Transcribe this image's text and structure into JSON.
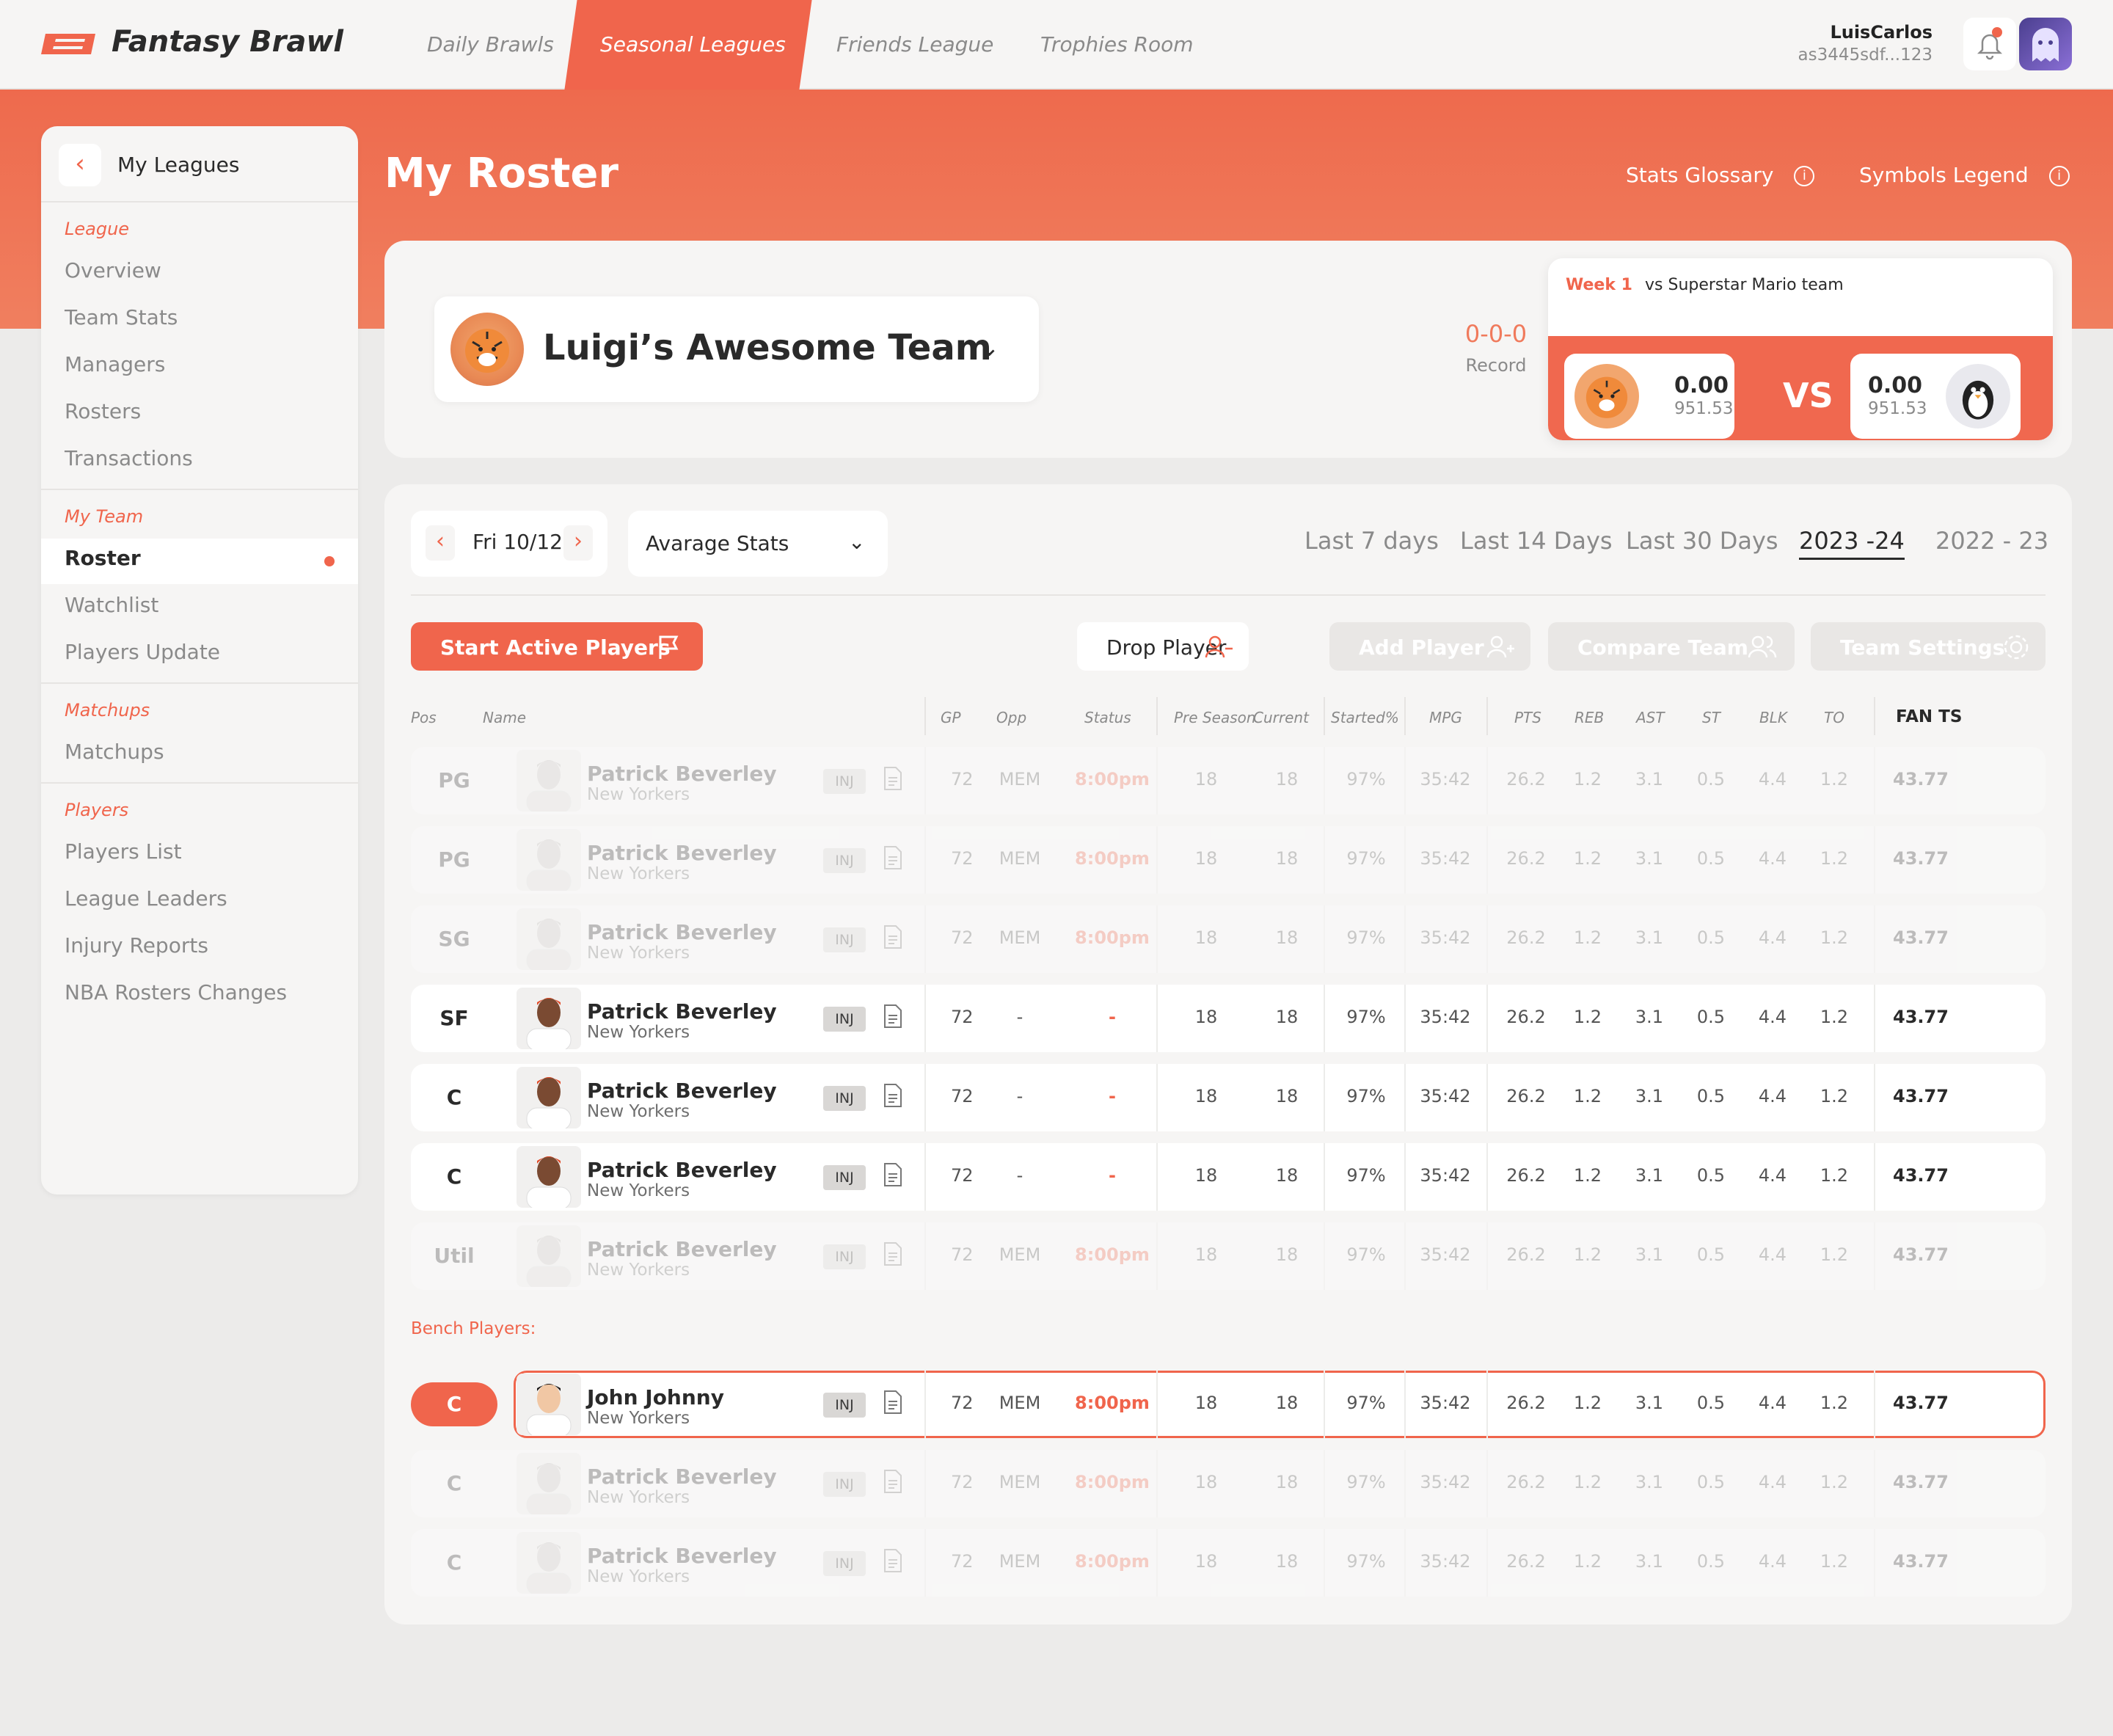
{
  "app": {
    "name": "Fantasy Brawl",
    "nav": [
      "Daily Brawls",
      "Seasonal Leagues",
      "Friends League",
      "Trophies Room"
    ],
    "user": {
      "name": "LuisCarlos",
      "id": "as3445sdf...123"
    }
  },
  "hero": {
    "title": "My Roster",
    "links": [
      "Stats Glossary",
      "Symbols Legend"
    ]
  },
  "sidebar": {
    "title": "My Leagues",
    "sections": [
      {
        "label": "League",
        "items": [
          "Overview",
          "Team Stats",
          "Managers",
          "Rosters",
          "Transactions"
        ]
      },
      {
        "label": "My Team",
        "items": [
          "Roster",
          "Watchlist",
          "Players Update"
        ]
      },
      {
        "label": "Matchups",
        "items": [
          "Matchups"
        ]
      },
      {
        "label": "Players",
        "items": [
          "Players List",
          "League Leaders",
          "Injury Reports",
          "NBA Rosters Changes"
        ]
      }
    ],
    "active": "Roster"
  },
  "team": {
    "name": "Luigi’s Awesome Team",
    "record_value": "0-0-0",
    "record_label": "Record",
    "week_label": "Week 1",
    "vs_text": "vs Superstar Mario team",
    "vs": "VS",
    "home": {
      "score": "0.00",
      "proj": "951.53"
    },
    "away": {
      "score": "0.00",
      "proj": "951.53"
    }
  },
  "roster": {
    "date": "Fri 10/12",
    "stats_mode": "Avarage Stats",
    "ranges": [
      "Last 7 days",
      "Last 14 Days",
      "Last 30 Days",
      "2023 -24",
      "2022 - 23"
    ],
    "active_range": "2023 -24",
    "buttons": {
      "start": "Start Active Players",
      "drop": "Drop Player",
      "add": "Add Player",
      "compare": "Compare Team",
      "settings": "Team Settings"
    },
    "columns": [
      "Pos",
      "Name",
      "GP",
      "Opp",
      "Status",
      "Pre Season",
      "Current",
      "Started%",
      "MPG",
      "PTS",
      "REB",
      "AST",
      "ST",
      "BLK",
      "TO",
      "FAN TS"
    ],
    "bench_label": "Bench Players:",
    "inj": "INJ",
    "starters": [
      {
        "pos": "PG",
        "name": "Patrick Beverley",
        "team": "New Yorkers",
        "gp": "72",
        "opp": "MEM",
        "status": "8:00pm",
        "pre": "18",
        "cur": "18",
        "started": "97%",
        "mpg": "35:42",
        "pts": "26.2",
        "reb": "1.2",
        "ast": "3.1",
        "st": "0.5",
        "blk": "4.4",
        "to": "1.2",
        "fan": "43.77",
        "dim": true
      },
      {
        "pos": "PG",
        "name": "Patrick Beverley",
        "team": "New Yorkers",
        "gp": "72",
        "opp": "MEM",
        "status": "8:00pm",
        "pre": "18",
        "cur": "18",
        "started": "97%",
        "mpg": "35:42",
        "pts": "26.2",
        "reb": "1.2",
        "ast": "3.1",
        "st": "0.5",
        "blk": "4.4",
        "to": "1.2",
        "fan": "43.77",
        "dim": true
      },
      {
        "pos": "SG",
        "name": "Patrick Beverley",
        "team": "New Yorkers",
        "gp": "72",
        "opp": "MEM",
        "status": "8:00pm",
        "pre": "18",
        "cur": "18",
        "started": "97%",
        "mpg": "35:42",
        "pts": "26.2",
        "reb": "1.2",
        "ast": "3.1",
        "st": "0.5",
        "blk": "4.4",
        "to": "1.2",
        "fan": "43.77",
        "dim": true
      },
      {
        "pos": "SF",
        "name": "Patrick Beverley",
        "team": "New Yorkers",
        "gp": "72",
        "opp": "-",
        "status": "-",
        "pre": "18",
        "cur": "18",
        "started": "97%",
        "mpg": "35:42",
        "pts": "26.2",
        "reb": "1.2",
        "ast": "3.1",
        "st": "0.5",
        "blk": "4.4",
        "to": "1.2",
        "fan": "43.77",
        "dim": false
      },
      {
        "pos": "C",
        "name": "Patrick Beverley",
        "team": "New Yorkers",
        "gp": "72",
        "opp": "-",
        "status": "-",
        "pre": "18",
        "cur": "18",
        "started": "97%",
        "mpg": "35:42",
        "pts": "26.2",
        "reb": "1.2",
        "ast": "3.1",
        "st": "0.5",
        "blk": "4.4",
        "to": "1.2",
        "fan": "43.77",
        "dim": false
      },
      {
        "pos": "C",
        "name": "Patrick Beverley",
        "team": "New Yorkers",
        "gp": "72",
        "opp": "-",
        "status": "-",
        "pre": "18",
        "cur": "18",
        "started": "97%",
        "mpg": "35:42",
        "pts": "26.2",
        "reb": "1.2",
        "ast": "3.1",
        "st": "0.5",
        "blk": "4.4",
        "to": "1.2",
        "fan": "43.77",
        "dim": false
      },
      {
        "pos": "Util",
        "name": "Patrick Beverley",
        "team": "New Yorkers",
        "gp": "72",
        "opp": "MEM",
        "status": "8:00pm",
        "pre": "18",
        "cur": "18",
        "started": "97%",
        "mpg": "35:42",
        "pts": "26.2",
        "reb": "1.2",
        "ast": "3.1",
        "st": "0.5",
        "blk": "4.4",
        "to": "1.2",
        "fan": "43.77",
        "dim": true
      }
    ],
    "bench": [
      {
        "pos": "C",
        "name": "John Johnny",
        "team": "New Yorkers",
        "gp": "72",
        "opp": "MEM",
        "status": "8:00pm",
        "pre": "18",
        "cur": "18",
        "started": "97%",
        "mpg": "35:42",
        "pts": "26.2",
        "reb": "1.2",
        "ast": "3.1",
        "st": "0.5",
        "blk": "4.4",
        "to": "1.2",
        "fan": "43.77",
        "dim": false,
        "selected": true
      },
      {
        "pos": "C",
        "name": "Patrick Beverley",
        "team": "New Yorkers",
        "gp": "72",
        "opp": "MEM",
        "status": "8:00pm",
        "pre": "18",
        "cur": "18",
        "started": "97%",
        "mpg": "35:42",
        "pts": "26.2",
        "reb": "1.2",
        "ast": "3.1",
        "st": "0.5",
        "blk": "4.4",
        "to": "1.2",
        "fan": "43.77",
        "dim": true
      },
      {
        "pos": "C",
        "name": "Patrick Beverley",
        "team": "New Yorkers",
        "gp": "72",
        "opp": "MEM",
        "status": "8:00pm",
        "pre": "18",
        "cur": "18",
        "started": "97%",
        "mpg": "35:42",
        "pts": "26.2",
        "reb": "1.2",
        "ast": "3.1",
        "st": "0.5",
        "blk": "4.4",
        "to": "1.2",
        "fan": "43.77",
        "dim": true
      }
    ]
  },
  "colors": {
    "accent": "#f0654c",
    "panel": "#f6f5f4",
    "background": "#ecebea"
  }
}
